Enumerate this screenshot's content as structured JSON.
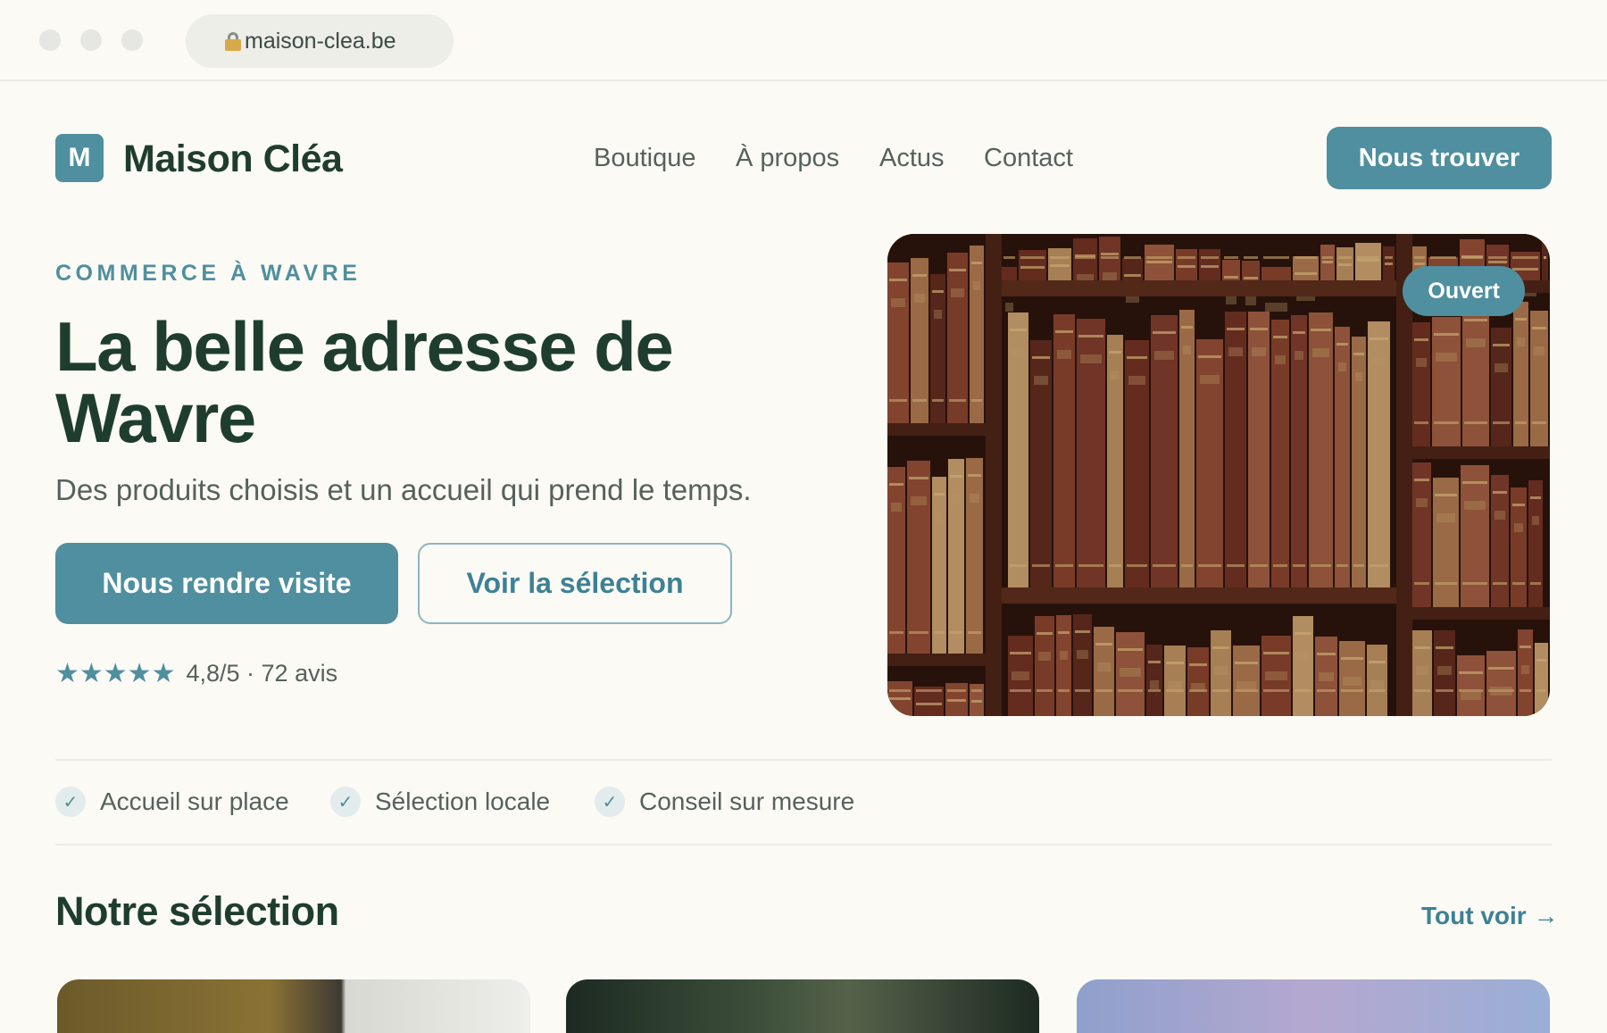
{
  "browser": {
    "url": "maison-clea.be"
  },
  "header": {
    "logo_letter": "M",
    "brand": "Maison Cléa",
    "nav": [
      "Boutique",
      "À propos",
      "Actus",
      "Contact"
    ],
    "cta": "Nous trouver"
  },
  "hero": {
    "eyebrow": "COMMERCE À WAVRE",
    "title": "La belle adresse de Wavre",
    "subtitle": "Des produits choisis et un accueil qui prend le temps.",
    "primary_button": "Nous rendre visite",
    "secondary_button": "Voir la sélection",
    "stars": "★★★★★",
    "rating_text": "4,8/5 · 72 avis",
    "rating_value": 4.8,
    "image_badge": "Ouvert"
  },
  "features": [
    {
      "icon": "check-icon",
      "label": "Accueil sur place"
    },
    {
      "icon": "check-icon",
      "label": "Sélection locale"
    },
    {
      "icon": "check-icon",
      "label": "Conseil sur mesure"
    }
  ],
  "selection": {
    "title": "Notre sélection",
    "see_all": "Tout voir →"
  },
  "colors": {
    "accent": "#4f8f9f",
    "heading": "#1f3d2e",
    "background": "#fbfaf4"
  }
}
